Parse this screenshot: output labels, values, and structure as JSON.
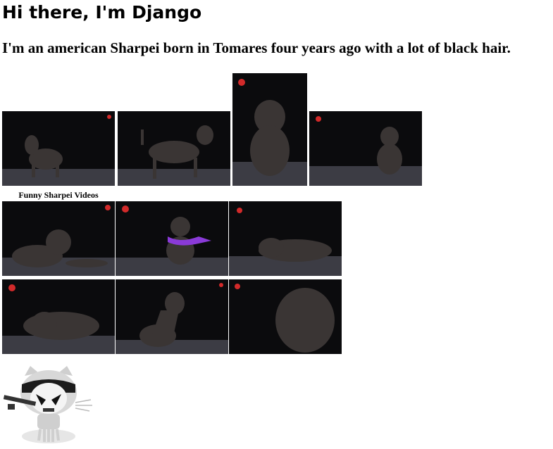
{
  "page": {
    "heading": "Hi there, I'm Django",
    "intro": "I'm an american Sharpei born in Tomares four years ago with a lot of black hair."
  },
  "gallery": {
    "row1": [
      {
        "pose": "standing-side",
        "alt": ""
      },
      {
        "pose": "standing-walk",
        "alt": ""
      },
      {
        "pose": "sitting-front",
        "alt": ""
      },
      {
        "pose": "standing-front",
        "alt": ""
      }
    ]
  },
  "videos": {
    "label": "Funny Sharpei Videos",
    "thumbnails": [
      {
        "pose": "lying-front"
      },
      {
        "pose": "sitting-scarf"
      },
      {
        "pose": "lying-side"
      },
      {
        "pose": "lying-rest"
      },
      {
        "pose": "sitting-side"
      },
      {
        "pose": "closeup-face"
      }
    ]
  },
  "mascot": {
    "icon": "stormtroopocat-icon"
  },
  "colors": {
    "photo_background": "#0b0b0d",
    "dog": "#3a3534",
    "floor": "#4a4a52",
    "badge": "#d22a2a",
    "scarf": "#8a3ad8"
  }
}
